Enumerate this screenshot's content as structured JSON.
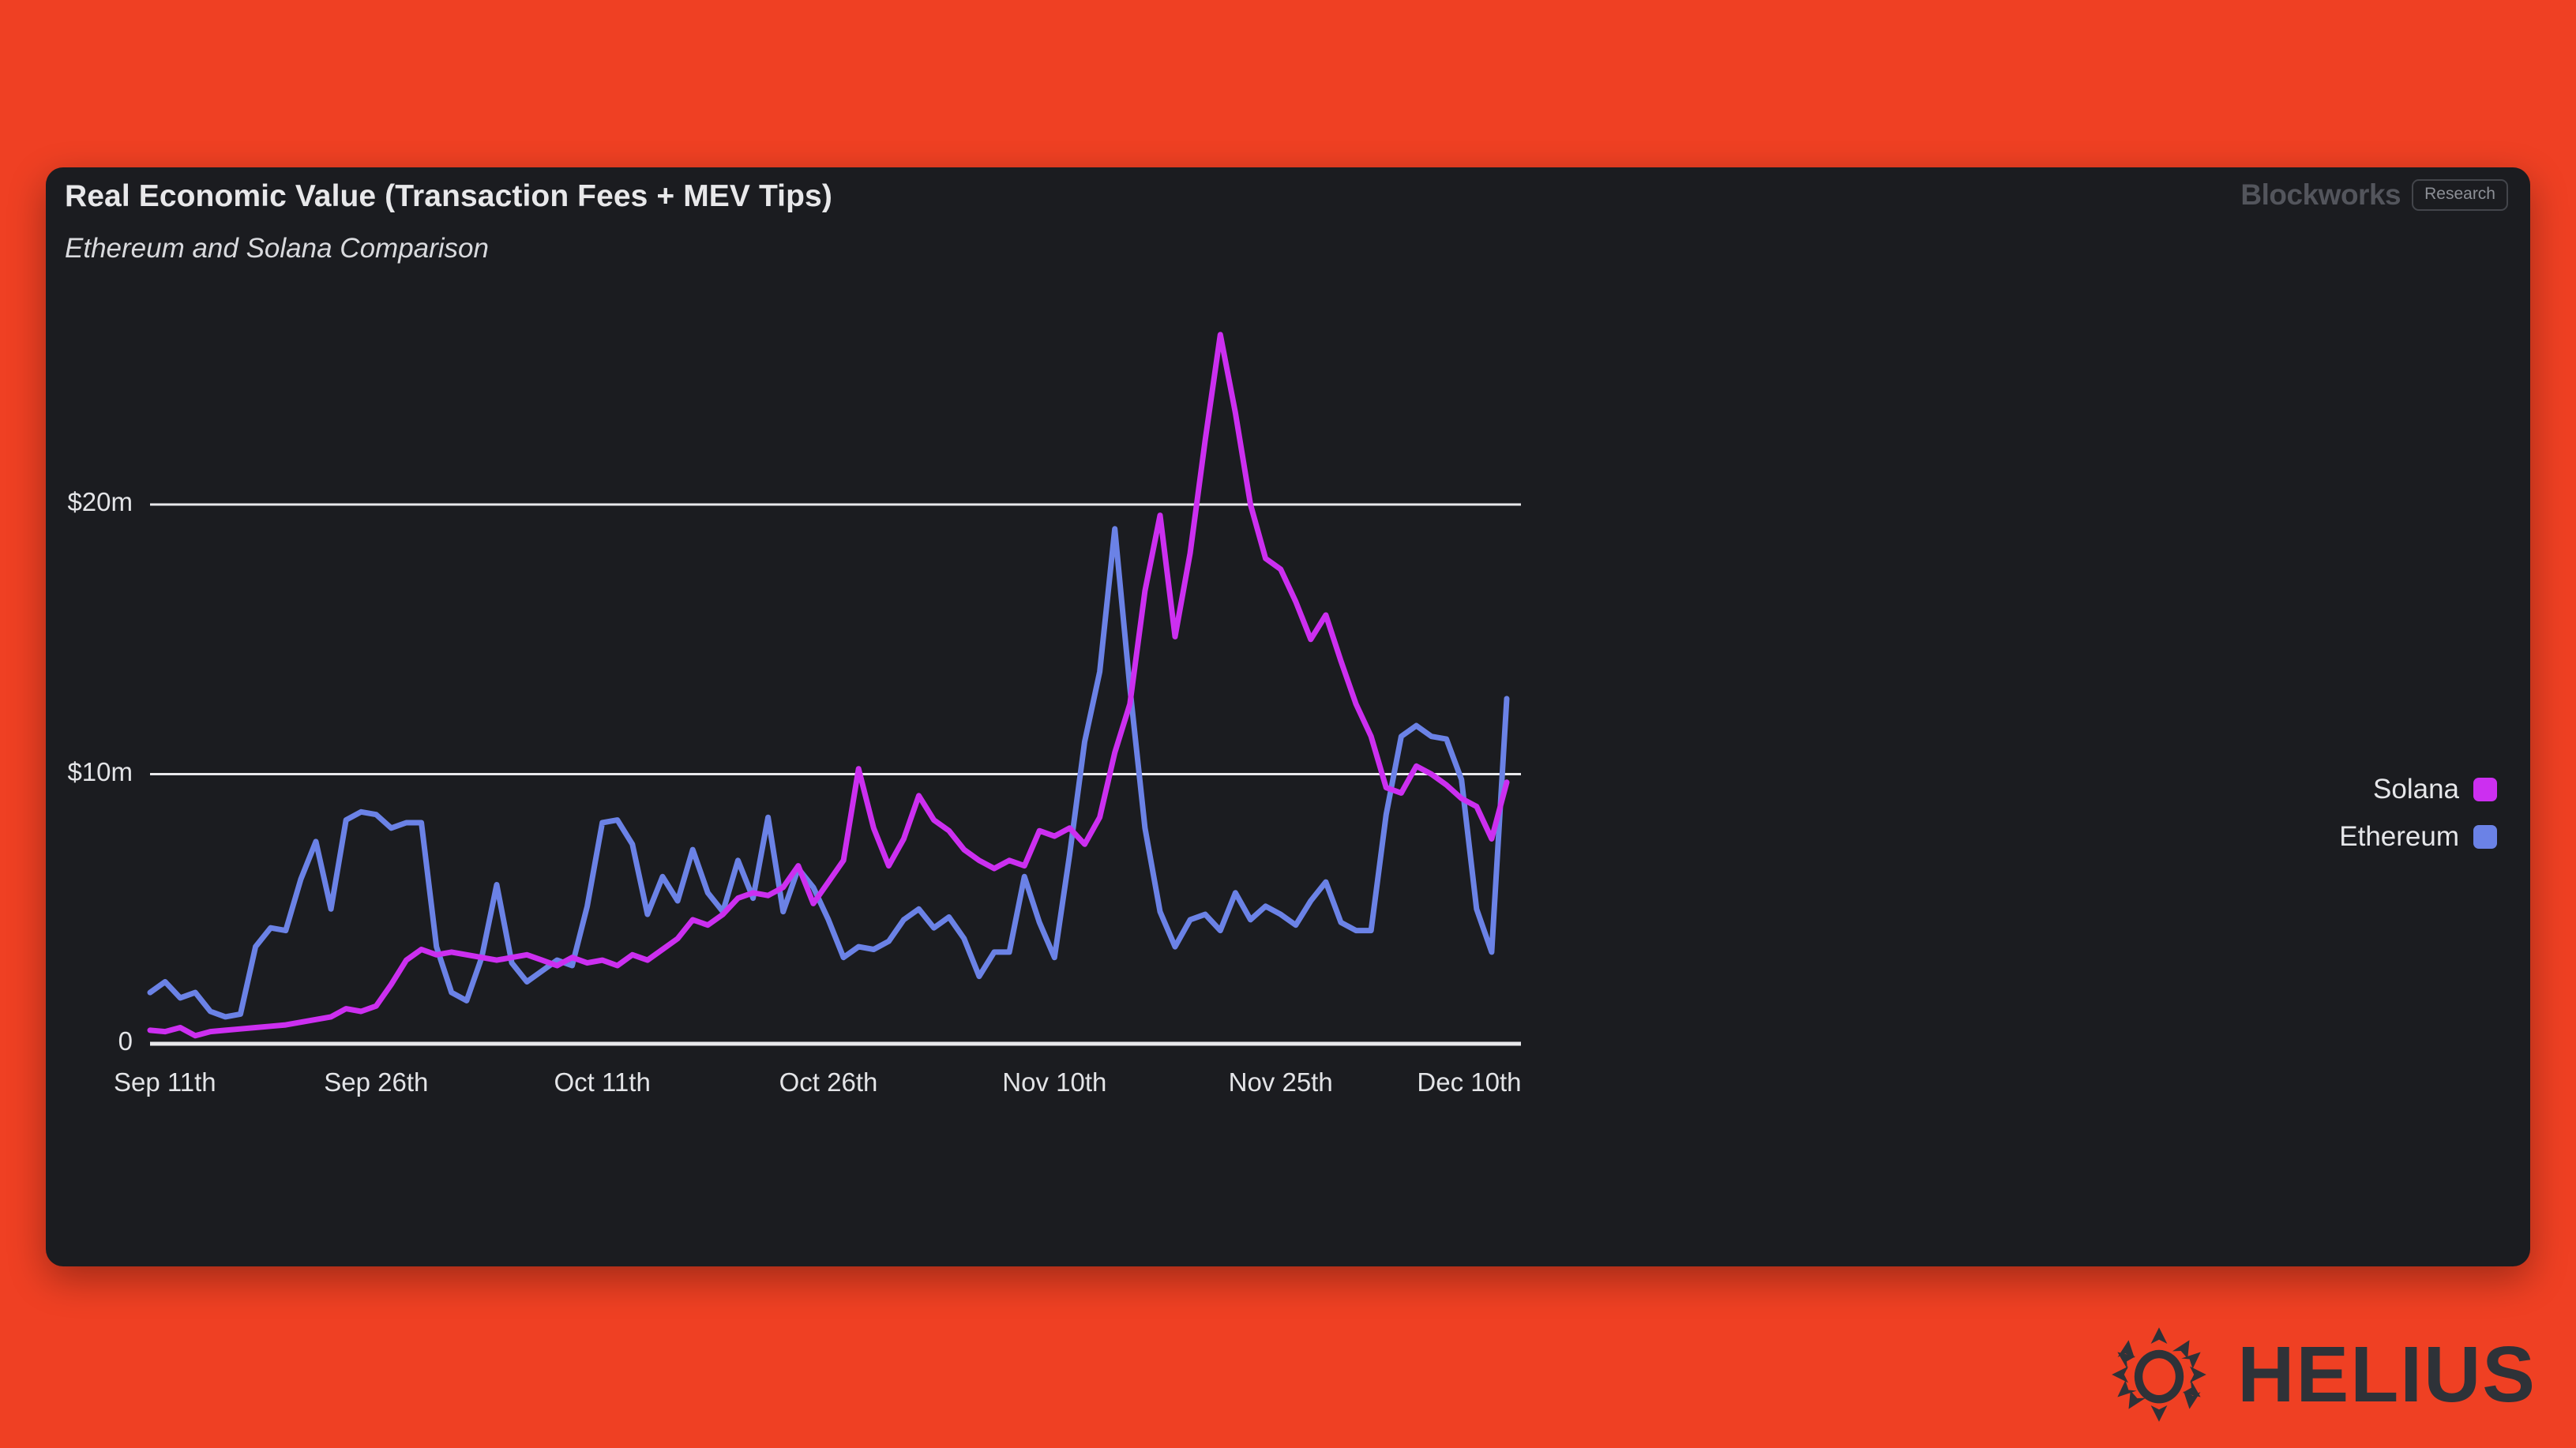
{
  "page": {
    "background_color": "#ef4023"
  },
  "card": {
    "background_color": "#1b1c20",
    "title": "Real Economic Value (Transaction Fees + MEV Tips)",
    "subtitle": "Ethereum and Solana Comparison"
  },
  "brand": {
    "name": "Blockworks",
    "badge": "Research"
  },
  "footer": {
    "logo_text": "HELIUS",
    "logo_icon": "helius-sun-icon"
  },
  "legend": {
    "position": "right",
    "entries": [
      {
        "label": "Solana",
        "color": "#cc2ff0"
      },
      {
        "label": "Ethereum",
        "color": "#6b82e6"
      }
    ]
  },
  "chart_data": {
    "type": "line",
    "title": "Real Economic Value (Transaction Fees + MEV Tips)",
    "subtitle": "Ethereum and Solana Comparison",
    "xlabel": "",
    "ylabel": "",
    "ylim": [
      0,
      27
    ],
    "yticks": [
      0,
      10,
      20
    ],
    "ytick_labels": [
      "0",
      "$10m",
      "$20m"
    ],
    "grid": "horizontal",
    "x_tick_labels": [
      "Sep 11th",
      "Sep 26th",
      "Oct 11th",
      "Oct 26th",
      "Nov 10th",
      "Nov 25th",
      "Dec 10th"
    ],
    "x_tick_indices": [
      0,
      15,
      30,
      45,
      60,
      75,
      90
    ],
    "x": [
      "Sep 11th",
      "Sep 12th",
      "Sep 13th",
      "Sep 14th",
      "Sep 15th",
      "Sep 16th",
      "Sep 17th",
      "Sep 18th",
      "Sep 19th",
      "Sep 20th",
      "Sep 21st",
      "Sep 22nd",
      "Sep 23rd",
      "Sep 24th",
      "Sep 25th",
      "Sep 26th",
      "Sep 27th",
      "Sep 28th",
      "Sep 29th",
      "Sep 30th",
      "Oct 1st",
      "Oct 2nd",
      "Oct 3rd",
      "Oct 4th",
      "Oct 5th",
      "Oct 6th",
      "Oct 7th",
      "Oct 8th",
      "Oct 9th",
      "Oct 10th",
      "Oct 11th",
      "Oct 12th",
      "Oct 13th",
      "Oct 14th",
      "Oct 15th",
      "Oct 16th",
      "Oct 17th",
      "Oct 18th",
      "Oct 19th",
      "Oct 20th",
      "Oct 21st",
      "Oct 22nd",
      "Oct 23rd",
      "Oct 24th",
      "Oct 25th",
      "Oct 26th",
      "Oct 27th",
      "Oct 28th",
      "Oct 29th",
      "Oct 30th",
      "Oct 31st",
      "Nov 1st",
      "Nov 2nd",
      "Nov 3rd",
      "Nov 4th",
      "Nov 5th",
      "Nov 6th",
      "Nov 7th",
      "Nov 8th",
      "Nov 9th",
      "Nov 10th",
      "Nov 11th",
      "Nov 12th",
      "Nov 13th",
      "Nov 14th",
      "Nov 15th",
      "Nov 16th",
      "Nov 17th",
      "Nov 18th",
      "Nov 19th",
      "Nov 20th",
      "Nov 21st",
      "Nov 22nd",
      "Nov 23rd",
      "Nov 24th",
      "Nov 25th",
      "Nov 26th",
      "Nov 27th",
      "Nov 28th",
      "Nov 29th",
      "Nov 30th",
      "Dec 1st",
      "Dec 2nd",
      "Dec 3rd",
      "Dec 4th",
      "Dec 5th",
      "Dec 6th",
      "Dec 7th",
      "Dec 8th",
      "Dec 9th",
      "Dec 10th"
    ],
    "units": "millions of USD",
    "series": [
      {
        "name": "Solana",
        "color": "#cc2ff0",
        "values": [
          0.5,
          0.45,
          0.6,
          0.3,
          0.45,
          0.5,
          0.55,
          0.6,
          0.65,
          0.7,
          0.8,
          0.9,
          1.0,
          1.3,
          1.2,
          1.4,
          2.2,
          3.1,
          3.5,
          3.3,
          3.4,
          3.3,
          3.2,
          3.1,
          3.2,
          3.3,
          3.1,
          2.9,
          3.2,
          3.0,
          3.1,
          2.9,
          3.3,
          3.1,
          3.5,
          3.9,
          4.6,
          4.4,
          4.8,
          5.4,
          5.6,
          5.5,
          5.8,
          6.6,
          5.2,
          6.0,
          6.8,
          10.2,
          8.0,
          6.6,
          7.6,
          9.2,
          8.3,
          7.9,
          7.2,
          6.8,
          6.5,
          6.8,
          6.6,
          7.9,
          7.7,
          8.0,
          7.4,
          8.4,
          10.8,
          12.6,
          16.8,
          19.6,
          15.1,
          18.2,
          22.4,
          26.3,
          23.4,
          20.0,
          18.0,
          17.6,
          16.4,
          15.0,
          15.9,
          14.2,
          12.6,
          11.4,
          9.5,
          9.3,
          10.3,
          10.0,
          9.6,
          9.1,
          8.8,
          7.6,
          9.7
        ]
      },
      {
        "name": "Ethereum",
        "color": "#6b82e6",
        "values": [
          1.9,
          2.3,
          1.7,
          1.9,
          1.2,
          1.0,
          1.1,
          3.6,
          4.3,
          4.2,
          6.1,
          7.5,
          5.0,
          8.3,
          8.6,
          8.5,
          8.0,
          8.2,
          8.2,
          3.6,
          1.9,
          1.6,
          3.2,
          5.9,
          3.0,
          2.3,
          2.7,
          3.1,
          2.9,
          5.1,
          8.2,
          8.3,
          7.4,
          4.8,
          6.2,
          5.3,
          7.2,
          5.6,
          4.9,
          6.8,
          5.4,
          8.4,
          4.9,
          6.5,
          5.8,
          4.6,
          3.2,
          3.6,
          3.5,
          3.8,
          4.6,
          5.0,
          4.3,
          4.7,
          3.9,
          2.5,
          3.4,
          3.4,
          6.2,
          4.5,
          3.2,
          7.0,
          11.2,
          13.8,
          19.1,
          13.2,
          8.0,
          4.9,
          3.6,
          4.6,
          4.8,
          4.2,
          5.6,
          4.6,
          5.1,
          4.8,
          4.4,
          5.3,
          6.0,
          4.5,
          4.2,
          4.2,
          8.5,
          11.4,
          11.8,
          11.4,
          11.3,
          9.8,
          5.0,
          3.4,
          12.8
        ]
      }
    ]
  }
}
